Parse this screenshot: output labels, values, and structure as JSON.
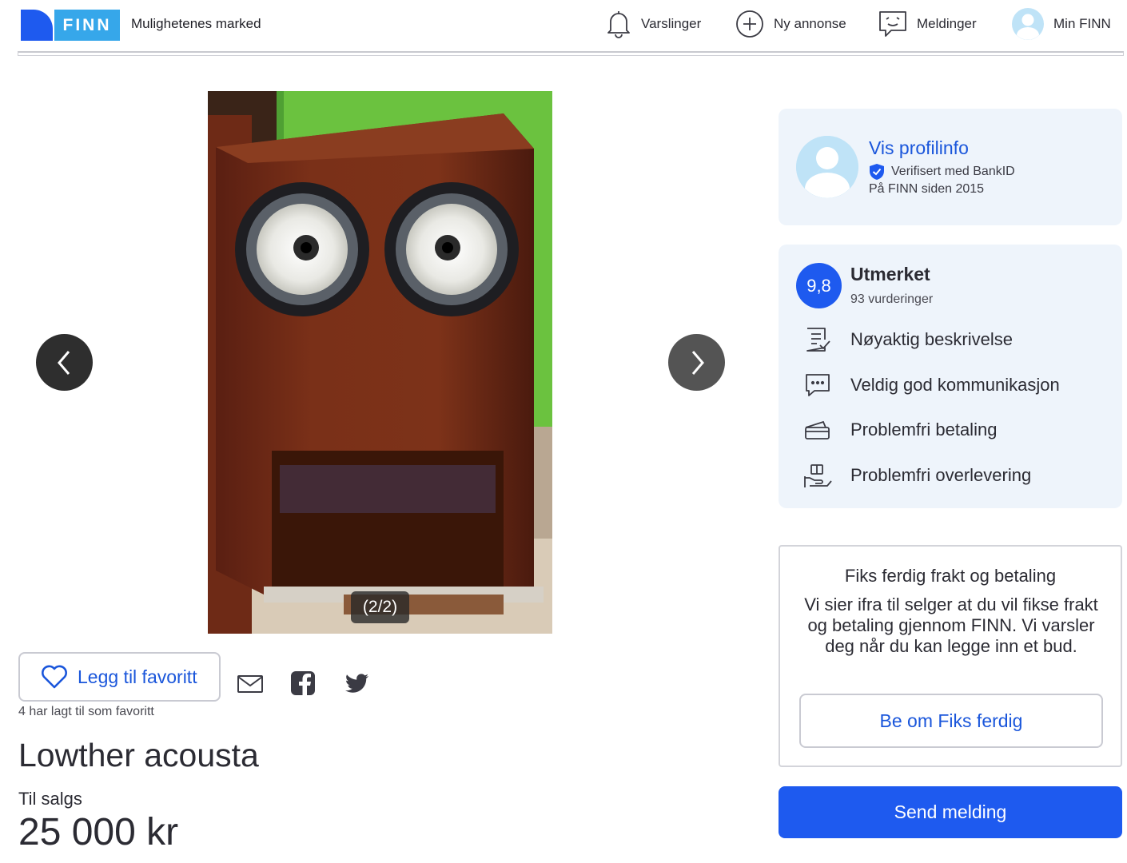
{
  "header": {
    "logo_text": "FINN",
    "tagline": "Mulighetenes marked",
    "nav": {
      "notifications": "Varslinger",
      "new_ad": "Ny annonse",
      "messages": "Meldinger",
      "my_finn": "Min FINN"
    }
  },
  "gallery": {
    "counter": "(2/2)",
    "image_icon": "speaker-photo"
  },
  "favorite": {
    "button_label": "Legg til favoritt",
    "count_text": "4 har lagt til som favoritt"
  },
  "share": {
    "icons": [
      "mail-icon",
      "facebook-icon",
      "twitter-icon"
    ]
  },
  "ad": {
    "title": "Lowther acousta",
    "status": "Til salgs",
    "price": "25 000 kr"
  },
  "profile": {
    "link": "Vis profilinfo",
    "verified": "Verifisert med BankID",
    "since": "På FINN siden 2015"
  },
  "rating": {
    "score": "9,8",
    "label": "Utmerket",
    "count": "93 vurderinger",
    "items": [
      {
        "icon": "checklist-icon",
        "label": "Nøyaktig beskrivelse"
      },
      {
        "icon": "chat-icon",
        "label": "Veldig god kommunikasjon"
      },
      {
        "icon": "card-icon",
        "label": "Problemfri betaling"
      },
      {
        "icon": "package-hand-icon",
        "label": "Problemfri overlevering"
      }
    ]
  },
  "fiks": {
    "title": "Fiks ferdig frakt og betaling",
    "text": "Vi sier ifra til selger at du vil fikse frakt og betaling gjennom FINN. Vi varsler deg når du kan legge inn et bud.",
    "button": "Be om Fiks ferdig"
  },
  "send_button": "Send melding",
  "colors": {
    "brand_blue": "#1e5aef",
    "logo_light_blue": "#36a7ea",
    "link_blue": "#1a56db",
    "card_bg": "#eef4fb"
  }
}
